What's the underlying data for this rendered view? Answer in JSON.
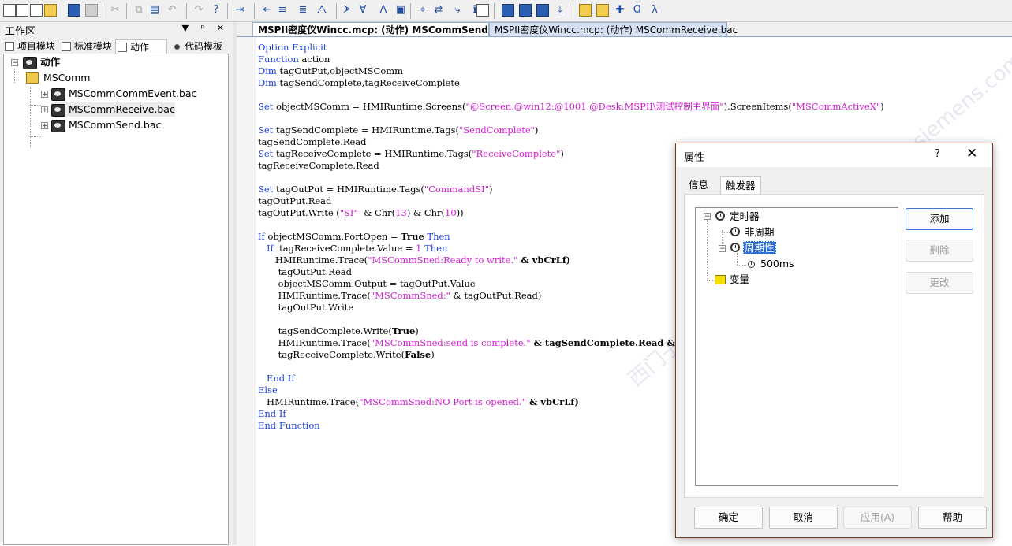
{
  "toolbar": {
    "icons": [
      "new-file-icon",
      "new-module-icon",
      "new-action-icon",
      "open-folder-icon",
      "save-icon",
      "print-icon",
      "cut-icon",
      "copy-icon",
      "paste-icon",
      "undo-icon",
      "redo-icon",
      "help-pointer-icon",
      "indent-icon",
      "outdent-icon",
      "comment-icon",
      "uncomment-icon",
      "bookmark-icon",
      "bookmark-next-icon",
      "bookmark-prev-icon",
      "bookmark-clear-icon",
      "compile-icon",
      "find-icon",
      "replace-icon",
      "goto-icon",
      "info-icon",
      "screen-icon",
      "tag-icon",
      "table-icon",
      "dialog-icon",
      "export-icon",
      "folder-icon",
      "add-folder-icon",
      "check-icon",
      "lambda-icon",
      "trigger-icon"
    ]
  },
  "workspace": {
    "title": "工作区",
    "pin_glyph": "▼ ᵖ ✕",
    "tabs": [
      {
        "label": "项目模块"
      },
      {
        "label": "标准模块"
      },
      {
        "label": "动作"
      },
      {
        "label": "代码模板"
      }
    ],
    "tree": {
      "root": "动作",
      "folder": "MSComm",
      "files": [
        "MSCommCommEvent.bac",
        "MSCommReceive.bac",
        "MSCommSend.bac"
      ]
    }
  },
  "editor": {
    "tabs": [
      {
        "label": "MSPII密度仪Wincc.mcp: (动作) MSCommSend.bac"
      },
      {
        "label": "MSPII密度仪Wincc.mcp: (动作) MSCommReceive.bac"
      }
    ],
    "code": {
      "l1": "Option Explicit",
      "l2": "Function",
      "l2b": " action",
      "l3": "Dim",
      "l3b": " tagOutPut,objectMSComm",
      "l4": "Dim",
      "l4b": " tagSendComplete,tagReceiveComplete",
      "l6a": "Set",
      "l6b": " objectMSComm = HMIRuntime.Screens(",
      "l6c": "\"@Screen.@win12:@1001.@Desk:MSPII\\测试控制主界面\"",
      "l6d": ").ScreenItems(",
      "l6e": "\"MSCommActiveX\"",
      "l6f": ")",
      "l8a": "Set",
      "l8b": " tagSendComplete = HMIRuntime.Tags(",
      "l8c": "\"SendComplete\"",
      "l8d": ")",
      "l9": "tagSendComplete.Read",
      "l10a": "Set",
      "l10b": " tagReceiveComplete = HMIRuntime.Tags(",
      "l10c": "\"ReceiveComplete\"",
      "l10d": ")",
      "l11": "tagReceiveComplete.Read",
      "l13a": "Set",
      "l13b": " tagOutPut = HMIRuntime.Tags(",
      "l13c": "\"CommandSI\"",
      "l13d": ")",
      "l14": "tagOutPut.Read",
      "l15a": "tagOutPut.Write (",
      "l15b": "\"SI\"",
      "l15c": "  & Chr(",
      "l15d": "13",
      "l15e": ") & Chr(",
      "l15f": "10",
      "l15g": "))",
      "l17a": "If",
      "l17b": " objectMSComm.PortOpen = ",
      "l17c": "True",
      "l17d": " Then",
      "l18a": "   If",
      "l18b": "  tagReceiveComplete.Value = ",
      "l18c": "1",
      "l18d": " Then",
      "l19a": "      HMIRuntime.Trace(",
      "l19b": "\"MSCommSned:Ready to write.\"",
      "l19c": " & vbCrLf)",
      "l20": "       tagOutPut.Read",
      "l21": "       objectMSComm.Output = tagOutPut.Value",
      "l22a": "       HMIRuntime.Trace(",
      "l22b": "\"MSCommSned:\"",
      "l22c": " & tagOutPut.Read)",
      "l23": "       tagOutPut.Write",
      "l25a": "       tagSendComplete.Write(",
      "l25b": "True",
      "l25c": ")",
      "l26a": "       HMIRuntime.Trace(",
      "l26b": "\"MSCommSned:send is complete.\"",
      "l26c": " & tagSendComplete.Read & vbCrLf)",
      "l27a": "       tagReceiveComplete.Write(",
      "l27b": "False",
      "l27c": ")",
      "l29": "   End If",
      "l30": "Else",
      "l31a": "   HMIRuntime.Trace(",
      "l31b": "\"MSCommSned:NO Port is opened.\"",
      "l31c": " & vbCrLf)",
      "l32": "End If",
      "l33": "End Function"
    }
  },
  "watermark": "西门子工业 技术论坛  support.industry.siemens.com/cs",
  "dialog": {
    "title": "属性",
    "help": "?",
    "close": "✕",
    "tabs": [
      {
        "label": "信息"
      },
      {
        "label": "触发器"
      }
    ],
    "tree": {
      "timer": "定时器",
      "acyclic": "非周期",
      "cyclic": "周期性",
      "interval": "500ms",
      "variable": "变量"
    },
    "side_buttons": {
      "add": "添加",
      "delete": "删除",
      "change": "更改"
    },
    "bottom_buttons": {
      "ok": "确定",
      "cancel": "取消",
      "apply": "应用(A)",
      "help": "帮助"
    }
  }
}
